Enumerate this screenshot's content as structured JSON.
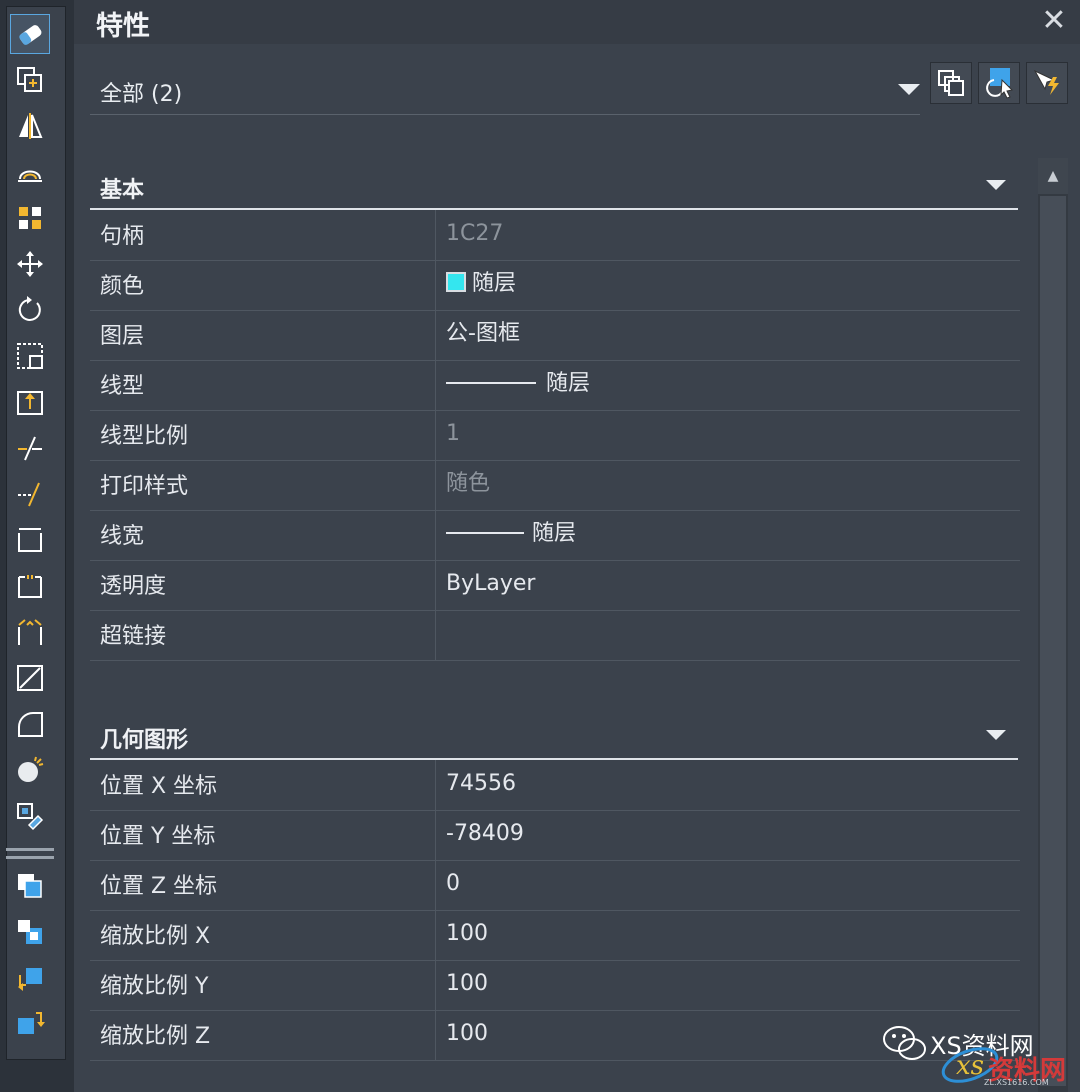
{
  "panel": {
    "title": "特性",
    "close": "✕"
  },
  "selection": {
    "value": "全部 (2)"
  },
  "sections": {
    "basic": {
      "title": "基本",
      "rows": [
        {
          "key": "句柄",
          "value": "1C27"
        },
        {
          "key": "颜色",
          "value": "随层"
        },
        {
          "key": "图层",
          "value": "公-图框"
        },
        {
          "key": "线型",
          "value": "随层"
        },
        {
          "key": "线型比例",
          "value": "1"
        },
        {
          "key": "打印样式",
          "value": "随色"
        },
        {
          "key": "线宽",
          "value": "随层"
        },
        {
          "key": "透明度",
          "value": "ByLayer"
        },
        {
          "key": "超链接",
          "value": ""
        }
      ]
    },
    "geometry": {
      "title": "几何图形",
      "rows": [
        {
          "key": "位置 X 坐标",
          "value": "74556"
        },
        {
          "key": "位置 Y 坐标",
          "value": "-78409"
        },
        {
          "key": "位置 Z 坐标",
          "value": "0"
        },
        {
          "key": "缩放比例 X",
          "value": "100"
        },
        {
          "key": "缩放比例 Y",
          "value": "100"
        },
        {
          "key": "缩放比例 Z",
          "value": "100"
        }
      ]
    }
  },
  "colors": {
    "layer_color": "#34e6ef",
    "accent": "#5aa7e0",
    "panel_bg": "#3b424c"
  },
  "watermark": {
    "text": "XS资料网",
    "logo_text": "资料网",
    "sub": "ZL.XS1616.COM"
  },
  "toolbar_icons": [
    "erase-icon",
    "copy-icon",
    "mirror-icon",
    "offset-icon",
    "array-icon",
    "move-icon",
    "rotate-icon",
    "scale-icon",
    "stretch-icon",
    "trim-icon",
    "extend-icon",
    "break-at-point-icon",
    "break-icon",
    "join-icon",
    "chamfer-icon",
    "fillet-icon",
    "explode-icon",
    "edit-block-icon",
    "bring-to-front-icon",
    "send-to-back-icon",
    "bring-above-icon",
    "send-under-icon"
  ]
}
